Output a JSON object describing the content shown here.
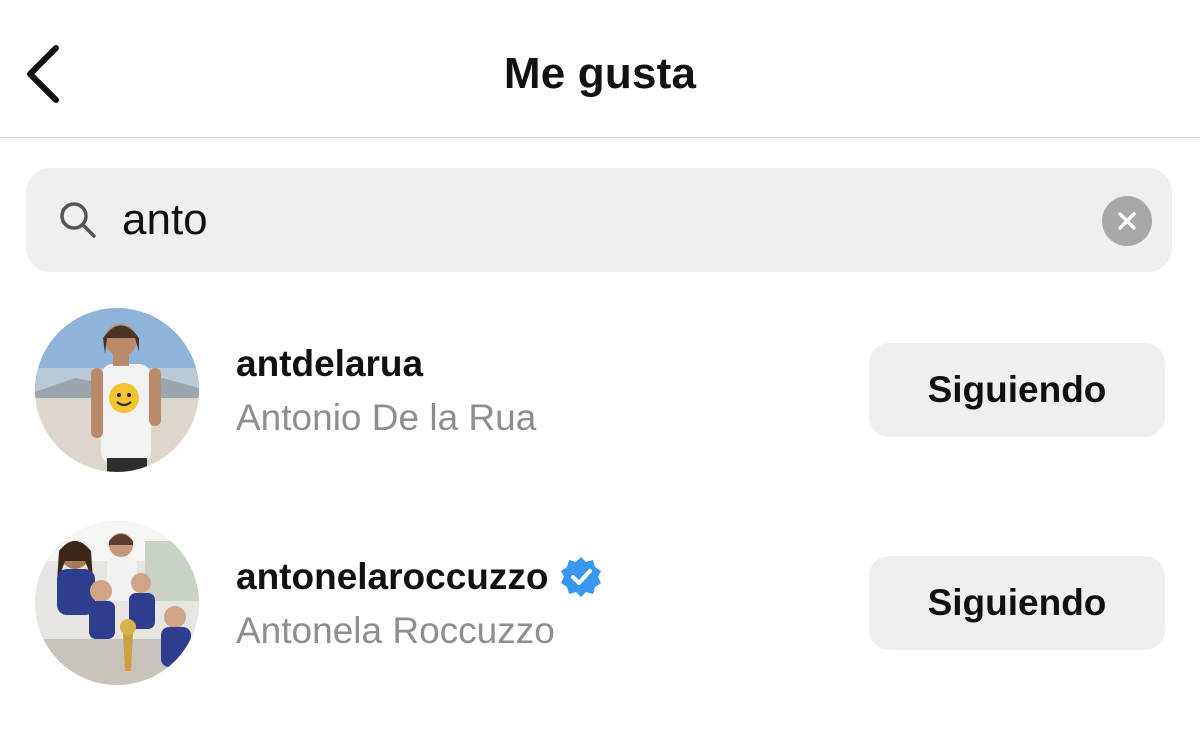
{
  "header": {
    "title": "Me gusta",
    "back_icon": "chevron-left-icon"
  },
  "search": {
    "value": "anto",
    "icon": "search-icon",
    "clear_icon": "clear-icon"
  },
  "results": [
    {
      "username": "antdelarua",
      "full_name": "Antonio De la Rua",
      "verified": false,
      "button_label": "Siguiendo"
    },
    {
      "username": "antonelaroccuzzo",
      "full_name": "Antonela Roccuzzo",
      "verified": true,
      "button_label": "Siguiendo"
    }
  ],
  "colors": {
    "text": "#111111",
    "secondary_text": "#8e8e8e",
    "field_background": "#efefef",
    "verified_badge": "#3897f0"
  }
}
